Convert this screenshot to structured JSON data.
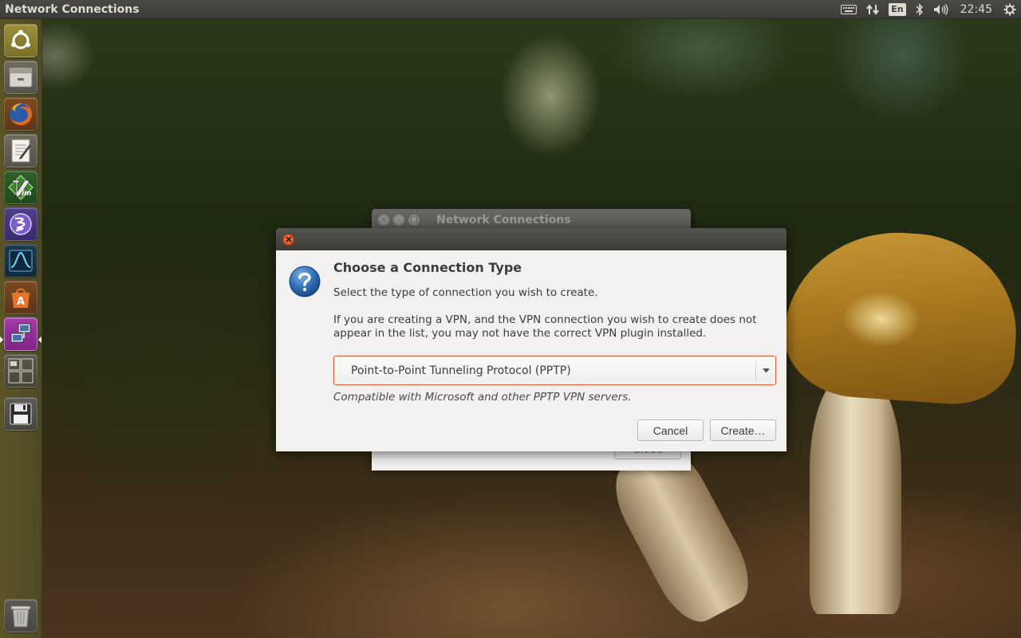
{
  "top_panel": {
    "app_title": "Network Connections",
    "language": "En",
    "clock": "22:45",
    "indicators": [
      "keyboard-icon",
      "network-icon",
      "language-badge",
      "bluetooth-icon",
      "volume-icon",
      "clock",
      "gear-icon"
    ]
  },
  "launcher": {
    "items": [
      {
        "name": "dash-home",
        "icon": "ubuntu-logo-icon",
        "active": false
      },
      {
        "name": "files",
        "icon": "files-icon",
        "active": false
      },
      {
        "name": "firefox",
        "icon": "firefox-icon",
        "active": false
      },
      {
        "name": "text-editor",
        "icon": "text-editor-icon",
        "active": false
      },
      {
        "name": "vim",
        "icon": "vim-icon",
        "active": false
      },
      {
        "name": "emacs",
        "icon": "emacs-icon",
        "active": false
      },
      {
        "name": "system-monitor",
        "icon": "system-monitor-icon",
        "active": false
      },
      {
        "name": "software-center",
        "icon": "software-center-icon",
        "active": false
      },
      {
        "name": "network-connections",
        "icon": "network-connections-icon",
        "active": true
      },
      {
        "name": "workspace-switcher",
        "icon": "workspace-switcher-icon",
        "active": false
      },
      {
        "name": "save-disk",
        "icon": "floppy-disk-icon",
        "active": false
      },
      {
        "name": "trash",
        "icon": "trash-icon",
        "active": false
      }
    ]
  },
  "background_window": {
    "title": "Network Connections",
    "close_label": "Close"
  },
  "dialog": {
    "heading": "Choose a Connection Type",
    "subtitle": "Select the type of connection you wish to create.",
    "vpn_note_line1": "If you are creating a VPN, and the VPN connection you wish to create does not",
    "vpn_note_line2": "appear in the list, you may not have the correct VPN plugin installed.",
    "selected_type": "Point-to-Point Tunneling Protocol (PPTP)",
    "type_description": "Compatible with Microsoft and other PPTP VPN servers.",
    "cancel_label": "Cancel",
    "create_label": "Create…"
  },
  "colors": {
    "panel": "#3c3b37",
    "close_button": "#e0582a",
    "focus_border": "#e0623a",
    "dialog_bg": "#f2f1f0"
  }
}
